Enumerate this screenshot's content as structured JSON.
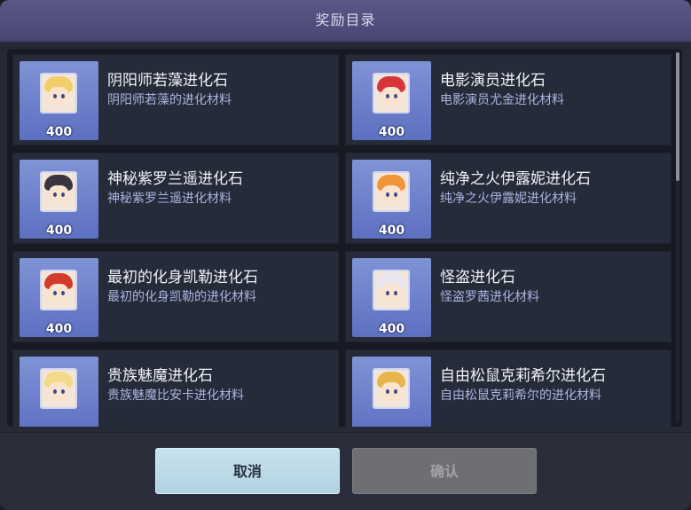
{
  "dialog": {
    "title": "奖励目录",
    "cancel_label": "取消",
    "confirm_label": "确认"
  },
  "rewards": [
    {
      "name": "阴阳师若藻进化石",
      "desc": "阴阳师若藻的进化材料",
      "qty": "400",
      "hair": "#f2cf6a"
    },
    {
      "name": "电影演员进化石",
      "desc": "电影演员尤金进化材料",
      "qty": "400",
      "hair": "#d8353a"
    },
    {
      "name": "神秘紫罗兰遥进化石",
      "desc": "神秘紫罗兰遥进化材料",
      "qty": "400",
      "hair": "#3a3440"
    },
    {
      "name": "纯净之火伊露妮进化石",
      "desc": "纯净之火伊露妮进化材料",
      "qty": "400",
      "hair": "#f0953a"
    },
    {
      "name": "最初的化身凯勒进化石",
      "desc": "最初的化身凯勒的进化材料",
      "qty": "400",
      "hair": "#d23a2c"
    },
    {
      "name": "怪盗进化石",
      "desc": "怪盗罗茜进化材料",
      "qty": "400",
      "hair": "#e8e6ee"
    },
    {
      "name": "贵族魅魔进化石",
      "desc": "贵族魅魔比安卡进化材料",
      "qty": "",
      "hair": "#f3d98a"
    },
    {
      "name": "自由松鼠克莉希尔进化石",
      "desc": "自由松鼠克莉希尔的进化材料",
      "qty": "",
      "hair": "#e8b54a"
    }
  ]
}
